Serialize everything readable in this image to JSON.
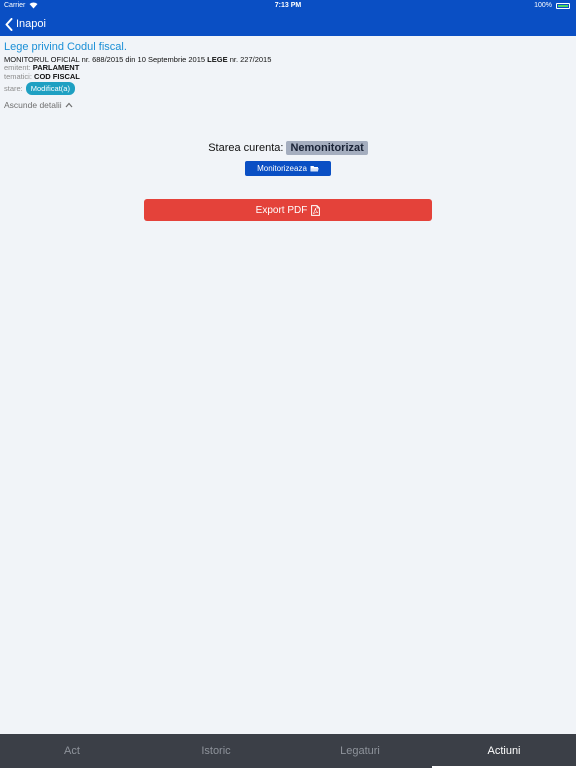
{
  "status_bar": {
    "carrier": "Carrier",
    "time": "7:13 PM",
    "battery": "100%",
    "battery_level": 1.0
  },
  "nav": {
    "back_label": "Inapoi"
  },
  "document": {
    "title": "Lege privind Codul fiscal.",
    "publication": "MONITORUL OFICIAL nr. 688/2015 din 10 Septembrie 2015",
    "type": "LEGE",
    "number": "nr. 227/2015",
    "issuer_label": "emitent:",
    "issuer": "PARLAMENT",
    "topic_label": "tematici:",
    "topic": "COD FISCAL",
    "state_label": "stare:",
    "state": "Modificat(a)",
    "toggle_label": "Ascunde detalii"
  },
  "actions": {
    "status_label": "Starea curenta:",
    "status_value": "Nemonitorizat",
    "monitor_label": "Monitorizeaza",
    "export_label": "Export PDF"
  },
  "tabs": [
    {
      "label": "Act",
      "active": false
    },
    {
      "label": "Istoric",
      "active": false
    },
    {
      "label": "Legaturi",
      "active": false
    },
    {
      "label": "Actiuni",
      "active": true
    }
  ],
  "colors": {
    "header": "#0a4fc4",
    "title": "#1a8fd6",
    "export": "#e4423a",
    "state_badge": "#1fa0c2",
    "tabbar": "#3b3f47"
  }
}
